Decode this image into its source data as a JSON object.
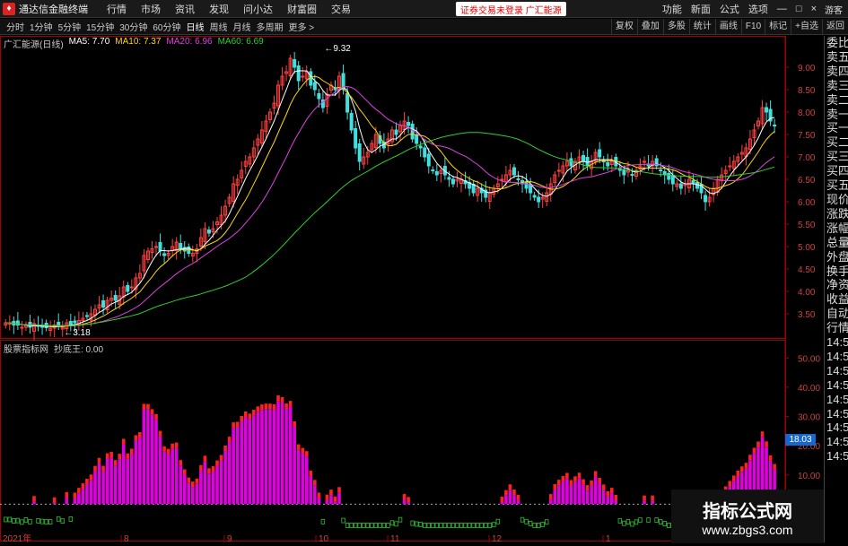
{
  "titlebar": {
    "app_title": "通达信金融终端",
    "logo_glyph": "♦",
    "menu": [
      "行情",
      "市场",
      "资讯",
      "发现",
      "问小达",
      "财富圈",
      "交易"
    ],
    "notice": "证券交易未登录   广汇能源",
    "right_menu": [
      "功能",
      "新面",
      "公式",
      "选项"
    ],
    "guest": "游客"
  },
  "toolbar": {
    "periods": [
      "分时",
      "1分钟",
      "5分钟",
      "15分钟",
      "30分钟",
      "60分钟",
      "日线",
      "周线",
      "月线",
      "多周期",
      "更多 >"
    ],
    "active_period": "日线",
    "buttons": [
      "复权",
      "叠加",
      "多股",
      "统计",
      "画线",
      "F10",
      "标记",
      "+自选",
      "返回"
    ]
  },
  "main_legend": {
    "stock": "广汇能源(日线)",
    "ma5": "MA5: 7.70",
    "ma10": "MA10: 7.37",
    "ma20": "MA20: 6.96",
    "ma60": "MA60: 6.69"
  },
  "sub_legend": {
    "source": "股票指标网",
    "indicator": "抄底王: 0.00"
  },
  "right_panel": [
    "委比",
    "卖五",
    "卖四",
    "卖三",
    "卖二",
    "卖一",
    "买一",
    "买二",
    "买三",
    "买四",
    "买五",
    "现价",
    "涨跌",
    "涨幅",
    "总量",
    "外盘",
    "换手",
    "净资",
    "收益",
    "自动",
    "行情",
    "14:50",
    "14:50",
    "14:50",
    "14:50",
    "14:50",
    "14:50",
    "14:50",
    "14:50",
    "14:50"
  ],
  "sub_badge": "18.03",
  "colors": {
    "ma5": "#ffffff",
    "ma10": "#ffd700",
    "ma20": "#e040e0",
    "ma60": "#2fd02f",
    "up": "#ff4040",
    "down": "#40e0e0",
    "axis": "#a00000"
  },
  "chart_data": [
    {
      "type": "candlestick",
      "title": "广汇能源(日线)",
      "y_ticks": [
        "9.00",
        "8.50",
        "8.00",
        "7.50",
        "7.00",
        "6.50",
        "6.00",
        "5.50",
        "5.00",
        "4.50",
        "4.00",
        "3.50"
      ],
      "ylim": [
        3.0,
        9.5
      ],
      "annotations": [
        {
          "label": "9.32",
          "x": 77,
          "y": 9.32
        },
        {
          "label": "3.18",
          "x": 13,
          "y": 3.18
        }
      ],
      "x_labels": [
        "2021年",
        "8",
        "9",
        "10",
        "11",
        "12",
        "1",
        "2",
        "3"
      ],
      "closes": [
        3.3,
        3.3,
        3.25,
        3.25,
        3.2,
        3.25,
        3.2,
        3.28,
        3.22,
        3.2,
        3.19,
        3.18,
        3.25,
        3.25,
        3.2,
        3.3,
        3.25,
        3.3,
        3.35,
        3.4,
        3.45,
        3.5,
        3.6,
        3.7,
        3.65,
        3.8,
        3.85,
        3.8,
        3.9,
        4.1,
        4.0,
        4.1,
        4.3,
        4.4,
        4.8,
        4.9,
        4.95,
        5.0,
        4.9,
        4.8,
        4.85,
        5.0,
        5.1,
        4.95,
        4.9,
        4.85,
        4.85,
        4.95,
        5.2,
        5.4,
        5.3,
        5.4,
        5.55,
        5.7,
        5.9,
        6.1,
        6.4,
        6.5,
        6.7,
        6.9,
        7.0,
        7.2,
        7.4,
        7.6,
        7.8,
        8.0,
        8.2,
        8.6,
        8.8,
        8.9,
        9.2,
        9.0,
        8.7,
        8.8,
        8.9,
        8.6,
        8.5,
        8.3,
        8.1,
        8.4,
        8.6,
        8.5,
        8.8,
        8.5,
        8.0,
        7.6,
        7.2,
        6.9,
        7.0,
        7.1,
        7.3,
        7.5,
        7.3,
        7.2,
        7.4,
        7.6,
        7.5,
        7.7,
        7.8,
        7.7,
        7.4,
        7.3,
        7.2,
        7.0,
        6.8,
        6.7,
        6.6,
        6.7,
        6.6,
        6.5,
        6.4,
        6.5,
        6.5,
        6.4,
        6.3,
        6.2,
        6.3,
        6.2,
        6.1,
        6.2,
        6.3,
        6.4,
        6.5,
        6.6,
        6.7,
        6.6,
        6.5,
        6.4,
        6.3,
        6.2,
        6.1,
        6.0,
        6.1,
        6.2,
        6.4,
        6.6,
        6.7,
        6.8,
        6.9,
        6.8,
        6.9,
        7.0,
        6.9,
        6.8,
        6.9,
        7.1,
        7.0,
        6.9,
        6.8,
        6.9,
        6.8,
        6.7,
        6.6,
        6.7,
        6.6,
        6.7,
        6.8,
        6.9,
        6.8,
        6.9,
        6.8,
        6.7,
        6.6,
        6.5,
        6.4,
        6.4,
        6.3,
        6.4,
        6.5,
        6.4,
        6.3,
        6.2,
        6.0,
        6.1,
        6.3,
        6.5,
        6.6,
        6.7,
        6.8,
        6.9,
        7.0,
        7.1,
        7.2,
        7.4,
        7.6,
        7.8,
        8.1,
        8.0,
        7.8,
        7.7
      ]
    },
    {
      "type": "bar",
      "title": "抄底王",
      "y_ticks": [
        "50.00",
        "40.00",
        "30.00",
        "20.00",
        "10.00"
      ],
      "ylim": [
        -10,
        55
      ]
    }
  ]
}
